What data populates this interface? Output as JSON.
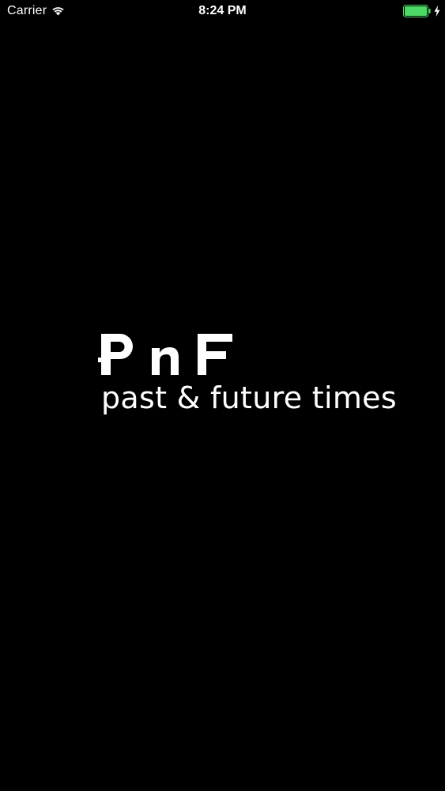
{
  "status_bar": {
    "carrier": "Carrier",
    "time": "8:24 PM",
    "wifi_icon": "wifi-icon",
    "battery_icon": "battery-icon",
    "charging_icon": "bolt-icon",
    "battery_color": "#4cd964"
  },
  "splash": {
    "logo_text": "PnF",
    "tagline": "past & future times"
  },
  "colors": {
    "background": "#000000",
    "foreground": "#ffffff"
  }
}
